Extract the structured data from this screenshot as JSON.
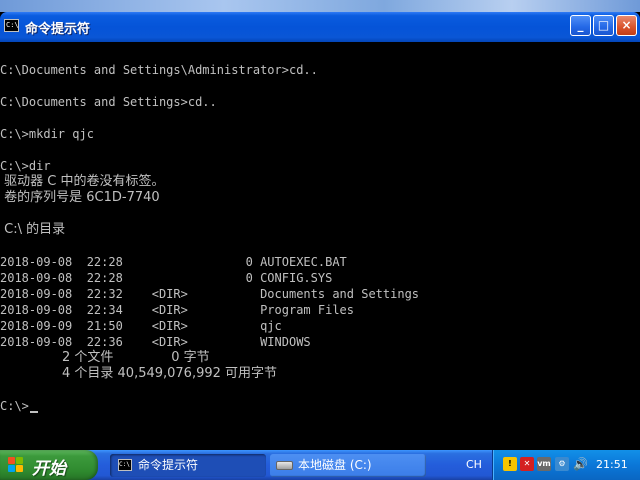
{
  "window": {
    "title": "命令提示符",
    "icon_text": "C:\\",
    "buttons": {
      "minimize": "_",
      "maximize": "□",
      "close": "×"
    }
  },
  "console": {
    "lines": [
      "C:\\Documents and Settings\\Administrator>cd..",
      "",
      "C:\\Documents and Settings>cd..",
      "",
      "C:\\>mkdir qjc",
      "",
      "C:\\>dir",
      " 驱动器 C 中的卷没有标签。",
      " 卷的序列号是 6C1D-7740",
      "",
      " C:\\ 的目录",
      "",
      "2018-09-08  22:28                 0 AUTOEXEC.BAT",
      "2018-09-08  22:28                 0 CONFIG.SYS",
      "2018-09-08  22:32    <DIR>          Documents and Settings",
      "2018-09-08  22:34    <DIR>          Program Files",
      "2018-09-09  21:50    <DIR>          qjc",
      "2018-09-08  22:36    <DIR>          WINDOWS",
      "               2 个文件              0 字节",
      "               4 个目录 40,549,076,992 可用字节",
      "",
      "C:\\>"
    ]
  },
  "taskbar": {
    "start_label": "开始",
    "tasks": [
      {
        "label": "命令提示符",
        "icon": "cmd-icon",
        "active": true
      },
      {
        "label": "本地磁盘 (C:)",
        "icon": "drive-icon",
        "active": false
      }
    ],
    "language": "CH",
    "tray_icons": [
      "network-warning-icon",
      "security-shield-icon",
      "vm-icon",
      "tools-icon",
      "volume-icon"
    ],
    "clock": "21:51"
  },
  "colors": {
    "console_text": "#c0c0c0",
    "console_bg": "#000000",
    "titlebar": "#0554d8",
    "start_button": "#3c9a3c",
    "tray": "#0b77d8"
  }
}
